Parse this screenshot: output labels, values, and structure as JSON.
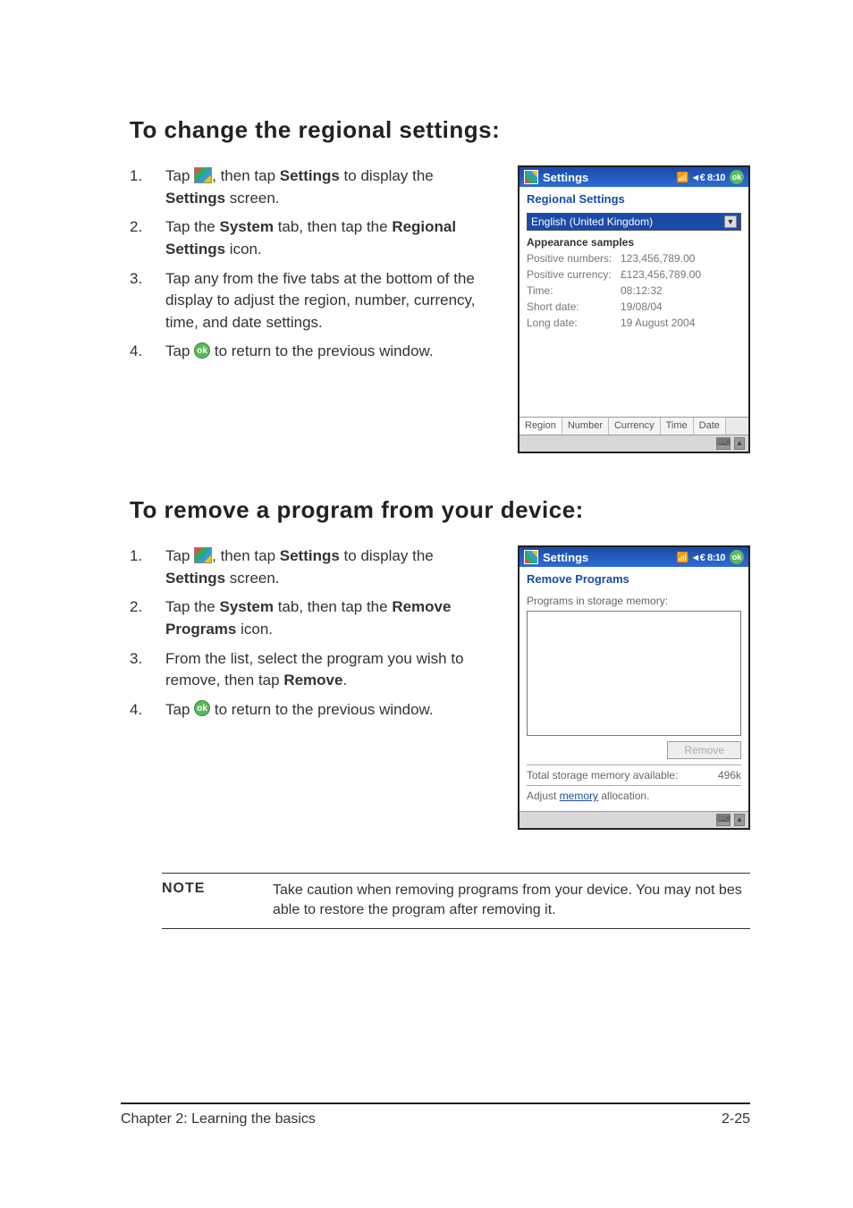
{
  "section1": {
    "heading": "To change the regional settings:",
    "steps": {
      "s1a": "Tap ",
      "s1b": ", then tap ",
      "s1c": "Settings",
      "s1d": " to display the ",
      "s1e": "Settings",
      "s1f": " screen.",
      "s2a": "Tap the ",
      "s2b": "System",
      "s2c": " tab, then tap the ",
      "s2d": "Regional Settings",
      "s2e": " icon.",
      "s3": "Tap any from the five tabs at the bottom of the display to adjust the region, number, currency, time, and date settings.",
      "s4a": "Tap ",
      "s4b": " to return to the previous window."
    },
    "pda": {
      "header_title": "Settings",
      "header_status": "◄€ 8:10",
      "title": "Regional Settings",
      "dropdown": "English (United Kingdom)",
      "appearance_label": "Appearance samples",
      "samples": [
        {
          "label": "Positive numbers:",
          "value": "123,456,789.00"
        },
        {
          "label": "Positive currency:",
          "value": "£123,456,789.00"
        },
        {
          "label": "Time:",
          "value": "08:12:32"
        },
        {
          "label": "Short date:",
          "value": "19/08/04"
        },
        {
          "label": "Long date:",
          "value": "19 August 2004"
        }
      ],
      "tabs": [
        "Region",
        "Number",
        "Currency",
        "Time",
        "Date"
      ]
    }
  },
  "section2": {
    "heading": "To remove a program from your device:",
    "steps": {
      "s1a": "Tap ",
      "s1b": ", then tap ",
      "s1c": "Settings",
      "s1d": " to display the ",
      "s1e": "Settings",
      "s1f": " screen.",
      "s2a": "Tap the ",
      "s2b": "System",
      "s2c": " tab, then tap the ",
      "s2d": "Remove Programs",
      "s2e": " icon.",
      "s3a": "From the list, select the program you wish to remove, then tap ",
      "s3b": "Remove",
      "s3c": ".",
      "s4a": "Tap ",
      "s4b": " to return to the previous window."
    },
    "pda": {
      "header_title": "Settings",
      "header_status": "◄€ 8:10",
      "title": "Remove Programs",
      "programs_label": "Programs in storage memory:",
      "remove_btn": "Remove",
      "mem_label": "Total storage memory available:",
      "mem_value": "496k",
      "adjust_pre": "Adjust ",
      "adjust_link": "memory",
      "adjust_post": " allocation."
    }
  },
  "note": {
    "label": "NOTE",
    "text": "Take caution when removing programs from your device. You may not bes able to restore the program after removing it."
  },
  "footer": {
    "left": "Chapter 2: Learning the basics",
    "right": "2-25"
  },
  "ok_text": "ok"
}
